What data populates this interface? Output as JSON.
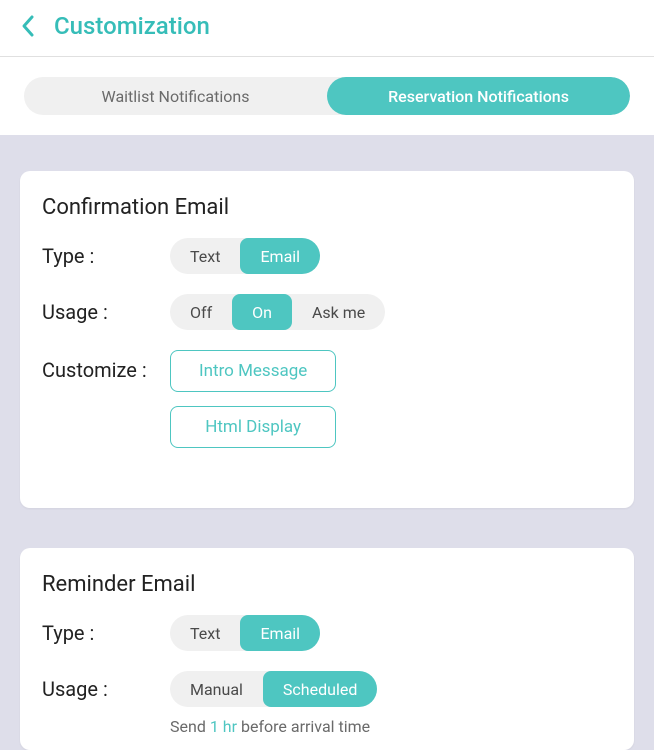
{
  "header": {
    "title": "Customization"
  },
  "tabs": {
    "waitlist": "Waitlist Notifications",
    "reservation": "Reservation Notifications"
  },
  "confirmation": {
    "title": "Confirmation Email",
    "labels": {
      "type": "Type :",
      "usage": "Usage :",
      "customize": "Customize :"
    },
    "type": {
      "text": "Text",
      "email": "Email"
    },
    "usage": {
      "off": "Off",
      "on": "On",
      "askme": "Ask me"
    },
    "buttons": {
      "intro": "Intro Message",
      "html": "Html Display"
    }
  },
  "reminder": {
    "title": "Reminder Email",
    "labels": {
      "type": "Type :",
      "usage": "Usage :"
    },
    "type": {
      "text": "Text",
      "email": "Email"
    },
    "usage": {
      "manual": "Manual",
      "scheduled": "Scheduled"
    },
    "send": {
      "prefix": "Send ",
      "value": "1 hr",
      "suffix": " before arrival time"
    }
  }
}
